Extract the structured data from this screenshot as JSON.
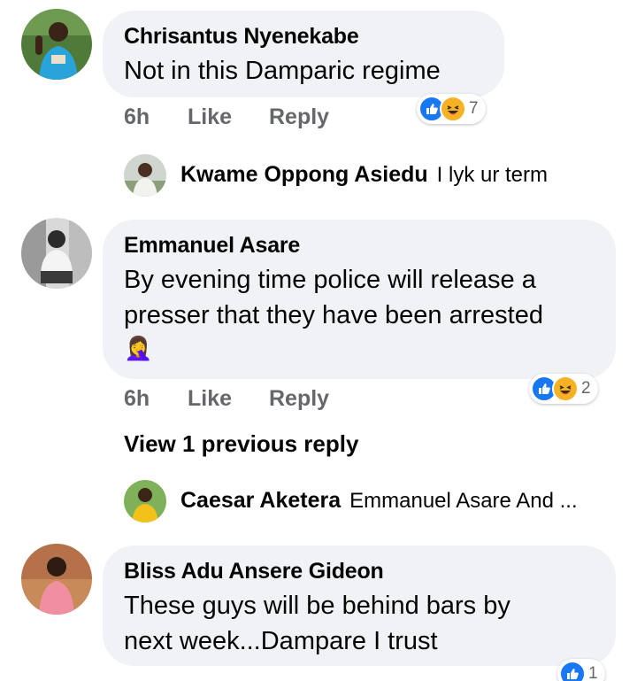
{
  "comments": [
    {
      "author": "Chrisantus Nyenekabe",
      "text": "Not in this Damparic regime",
      "time": "6h",
      "like_label": "Like",
      "reply_label": "Reply",
      "reaction_count": "7",
      "reactions": [
        "like-icon",
        "haha-icon"
      ],
      "reply_preview": {
        "author": "Kwame Oppong Asiedu",
        "text": "I lyk ur term"
      }
    },
    {
      "author": "Emmanuel Asare",
      "text_line1": "By evening  time police will release a",
      "text_line2": "presser that they have been arrested",
      "emoji": "🤦‍♀️",
      "time": "6h",
      "like_label": "Like",
      "reply_label": "Reply",
      "reaction_count": "2",
      "reactions": [
        "like-icon",
        "haha-icon"
      ],
      "view_previous": "View 1 previous reply",
      "reply_preview": {
        "author": "Caesar Aketera",
        "text": "Emmanuel Asare  And ..."
      }
    },
    {
      "author": "Bliss Adu Ansere Gideon",
      "text_line1": "These guys will be behind bars by",
      "text_line2": "next week...Dampare I trust",
      "reaction_count": "1",
      "reactions": [
        "like-icon"
      ]
    }
  ],
  "colors": {
    "bubble": "#f0f2f5",
    "meta_text": "#65676b",
    "like_blue": "#1877f2",
    "haha_yellow": "#f7b125"
  }
}
